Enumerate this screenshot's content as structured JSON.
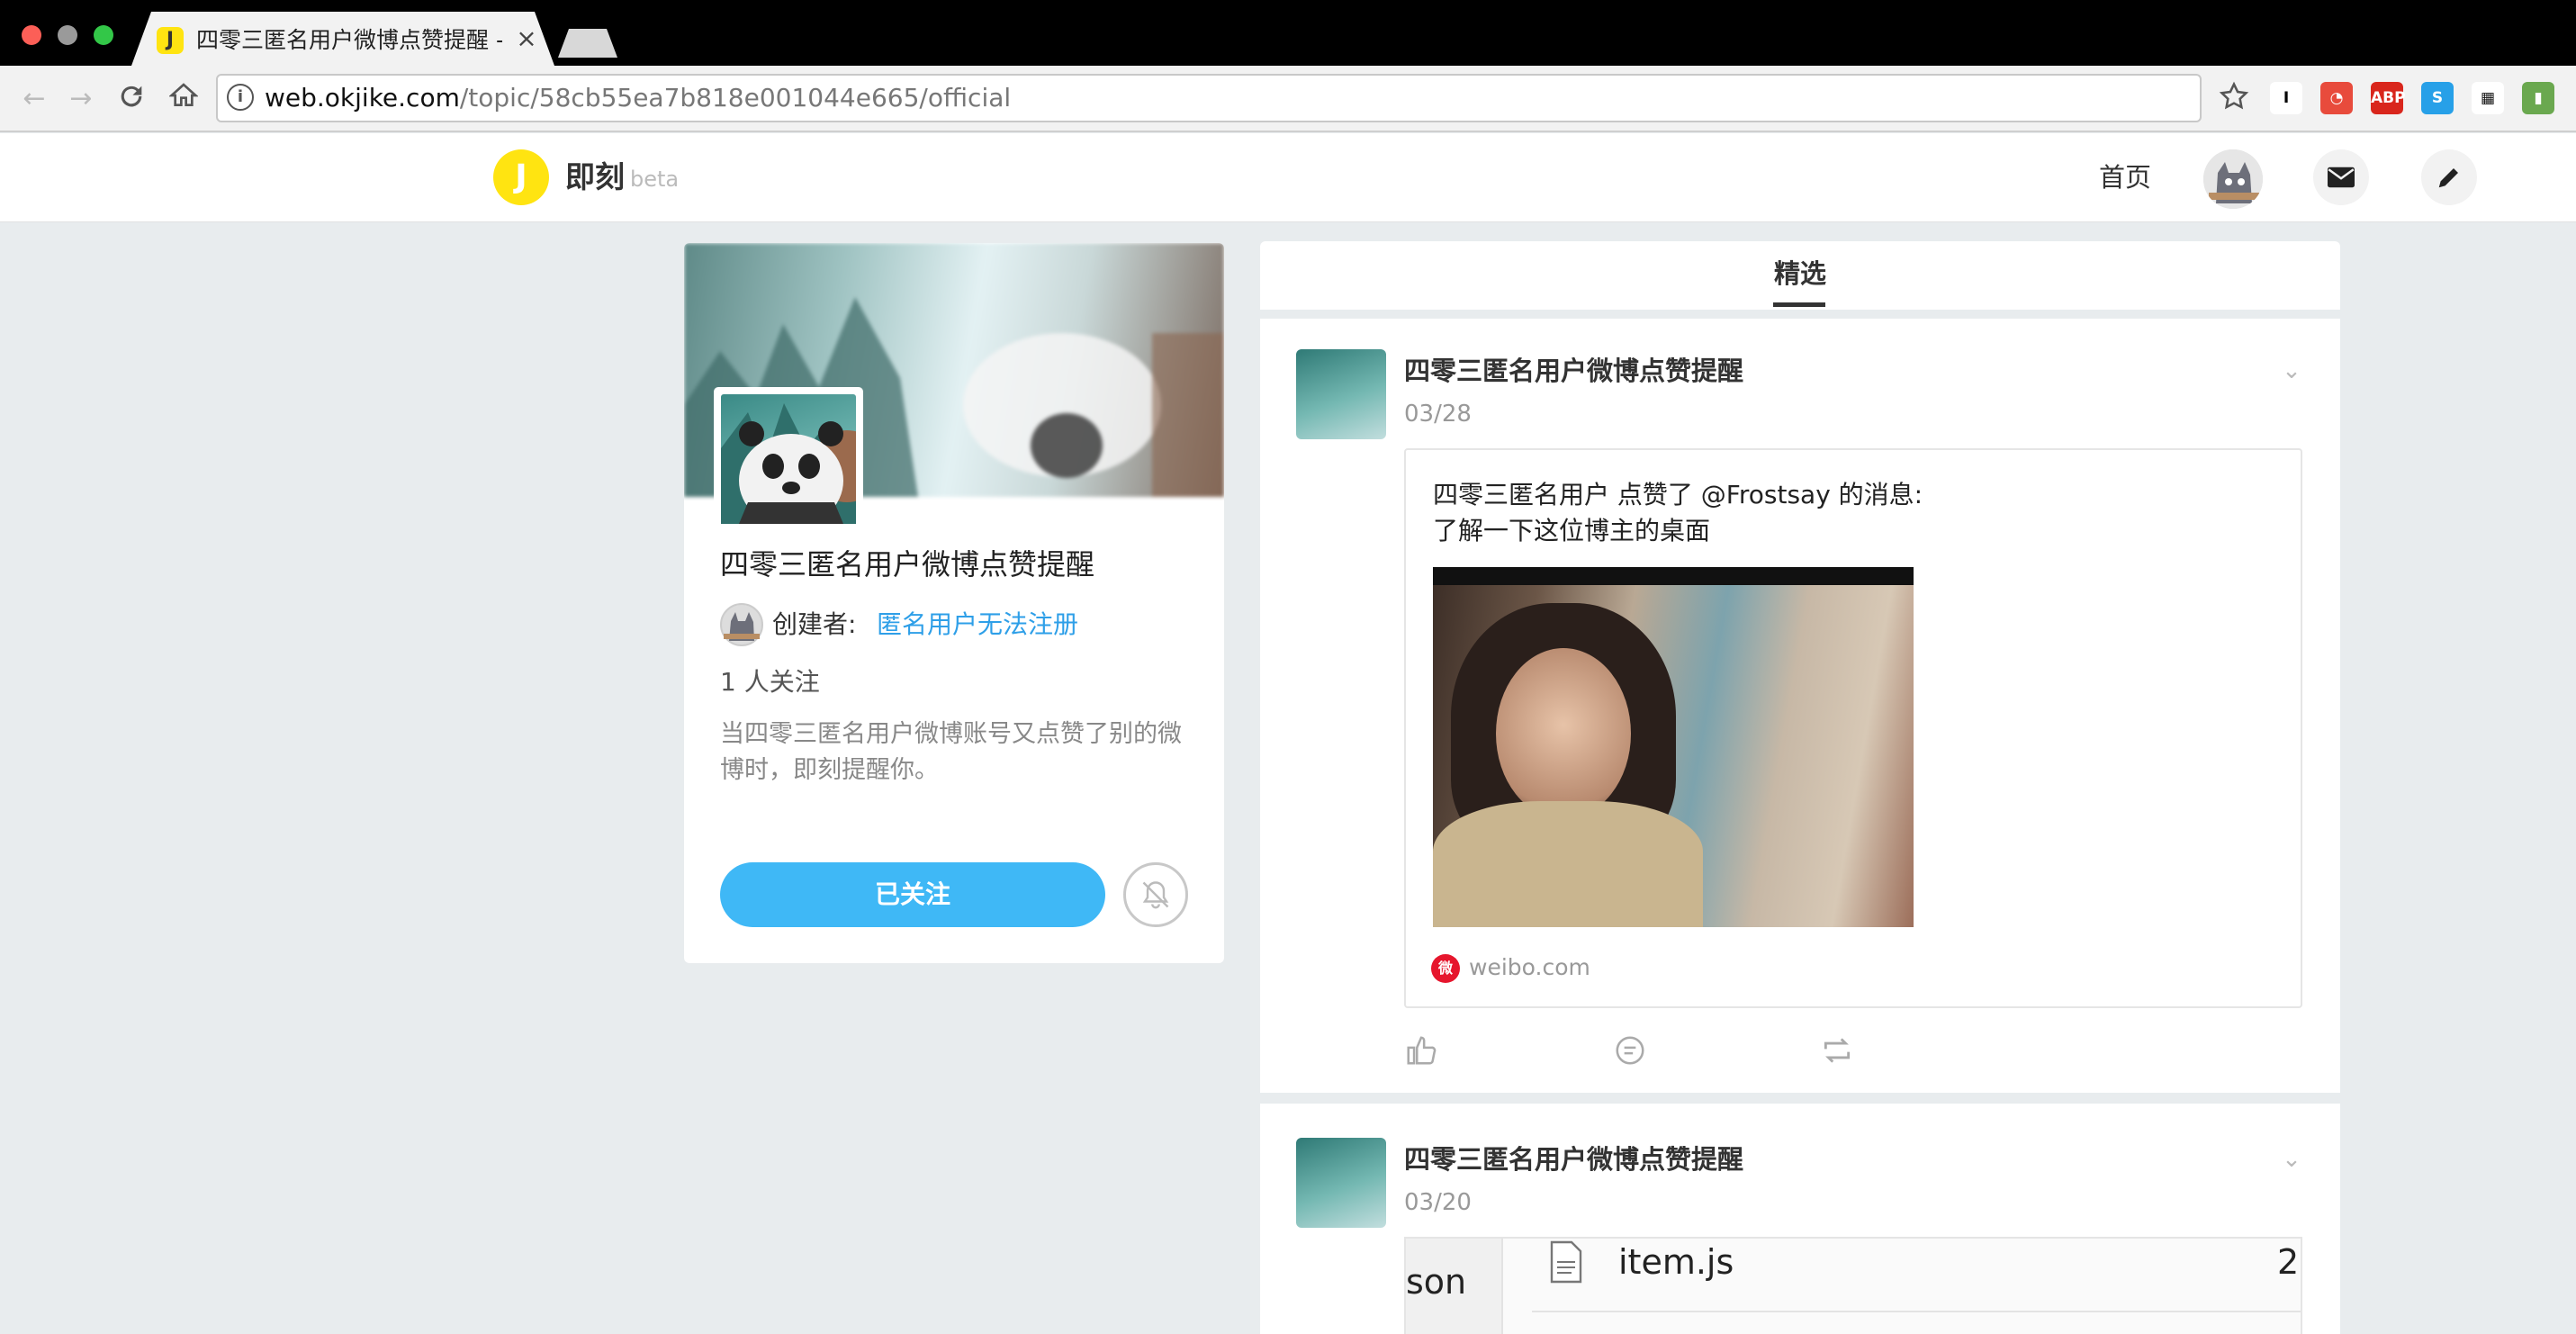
{
  "browser": {
    "tab_title": "四零三匿名用户微博点赞提醒 -",
    "tab_favicon": "J",
    "tab_close": "×",
    "url_host": "web.okjike.com",
    "url_path": "/topic/58cb55ea7b818e001044e665/official",
    "icons": [
      "back-icon",
      "forward-icon",
      "reload-icon",
      "home-icon",
      "info-icon",
      "star-icon"
    ],
    "extensions": [
      {
        "label": "I",
        "color": "#ffffff",
        "fg": "#000000"
      },
      {
        "label": "◔",
        "color": "#e84b3c",
        "fg": "#ffffff"
      },
      {
        "label": "ABP",
        "color": "#d9261c",
        "fg": "#ffffff"
      },
      {
        "label": "S",
        "color": "#27a0e8",
        "fg": "#ffffff"
      },
      {
        "label": "▦",
        "color": "#ffffff",
        "fg": "#111111"
      },
      {
        "label": "▮",
        "color": "#6aa84f",
        "fg": "#ffffff"
      }
    ]
  },
  "site": {
    "logo": "J",
    "brand": "即刻",
    "beta": "beta",
    "nav_home": "首页"
  },
  "topic": {
    "name": "四零三匿名用户微博点赞提醒",
    "creator_label": "创建者:",
    "creator_name": "匿名用户无法注册",
    "followers": "1 人关注",
    "description": "当四零三匿名用户微博账号又点赞了别的微博时，即刻提醒你。",
    "follow_button": "已关注"
  },
  "feed": {
    "tab": "精选",
    "posts": [
      {
        "title": "四零三匿名用户微博点赞提醒",
        "date": "03/28",
        "line1": "四零三匿名用户 点赞了 @Frostsay 的消息:",
        "line2": "了解一下这位博主的桌面",
        "source": "weibo.com"
      },
      {
        "title": "四零三匿名用户微博点赞提醒",
        "date": "03/20",
        "preview_left": "son",
        "preview_file": "item.js",
        "preview_num": "2"
      }
    ]
  }
}
